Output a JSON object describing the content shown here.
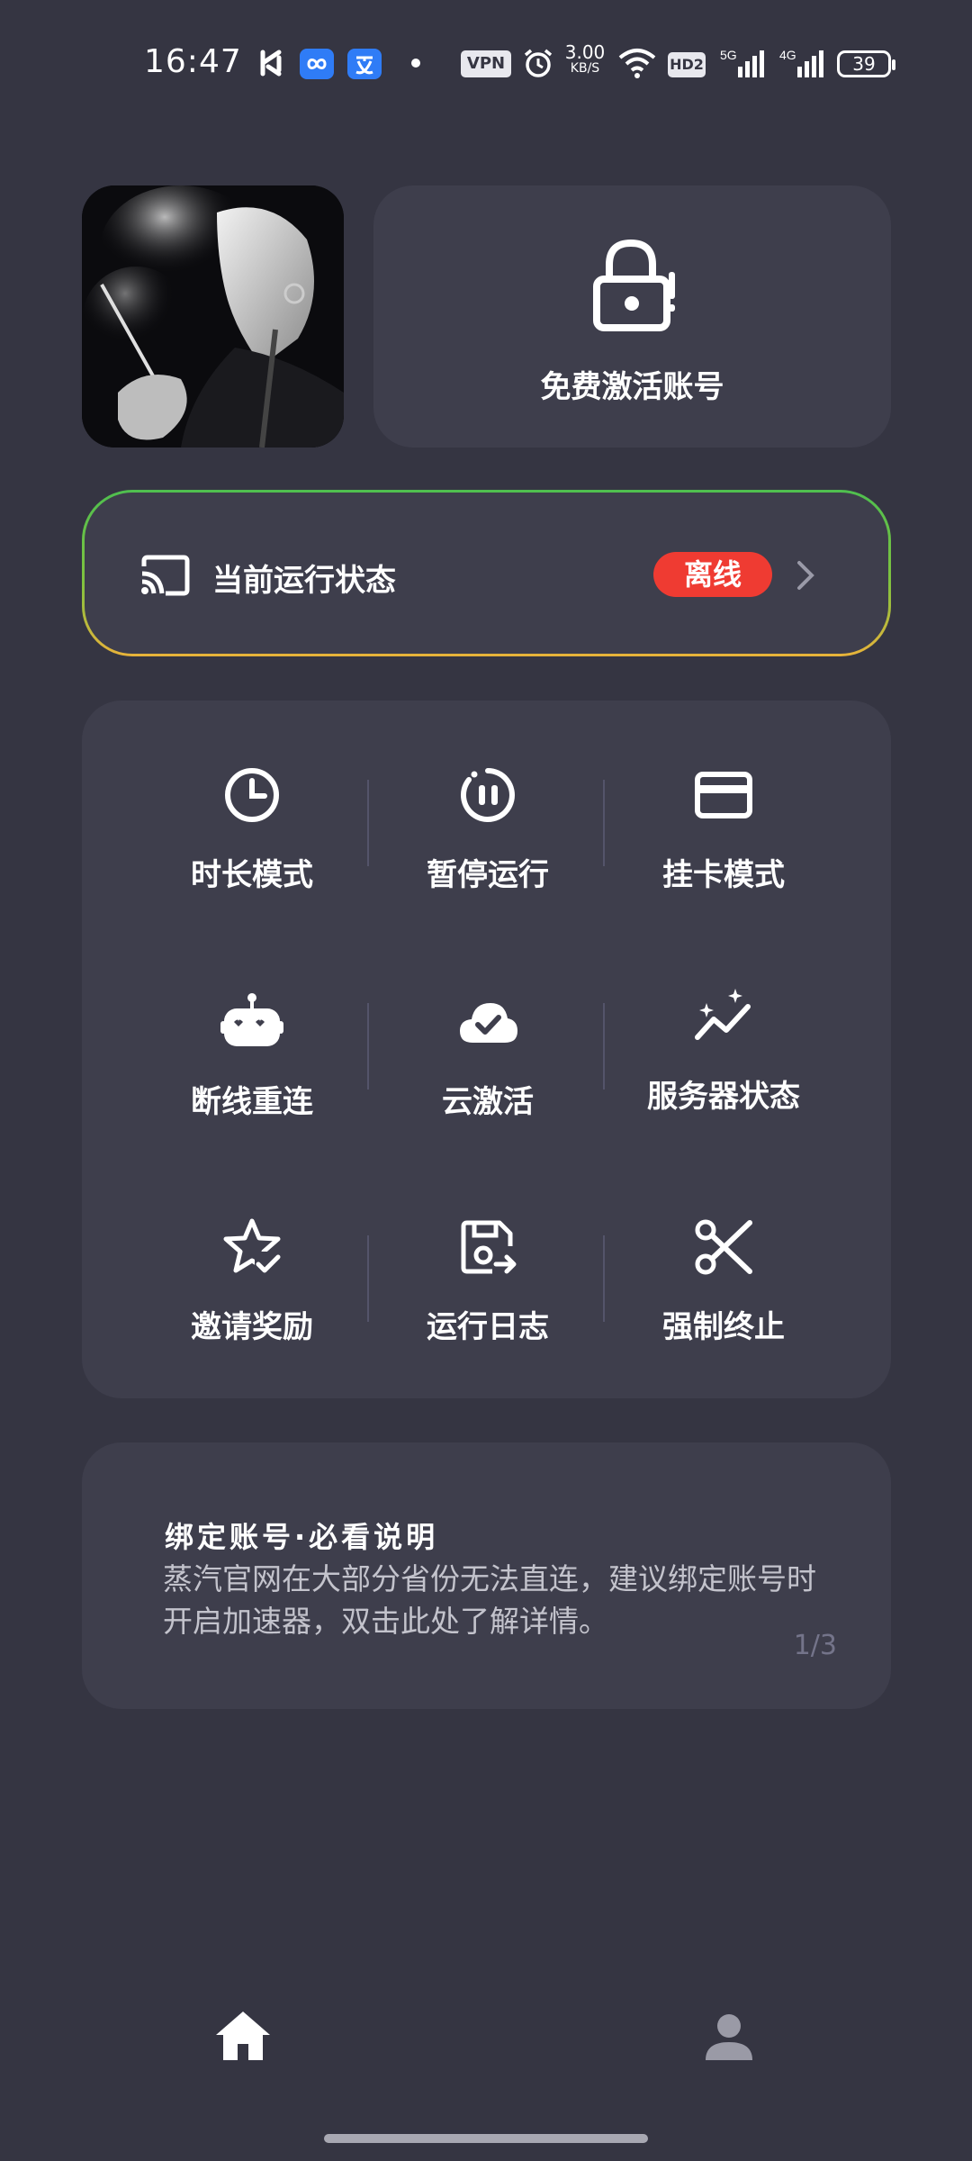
{
  "status_bar": {
    "time": "16:47",
    "vpn": "VPN",
    "speed_value": "3.00",
    "speed_unit": "KB/S",
    "hd": "HD2",
    "network_5g": "5G",
    "network_4g": "4G",
    "battery": "39"
  },
  "account": {
    "activate_label": "免费激活账号"
  },
  "run_status": {
    "label": "当前运行状态",
    "badge": "离线",
    "badge_color": "#ef3b32"
  },
  "grid": [
    {
      "label": "时长模式",
      "icon": "clock-icon"
    },
    {
      "label": "暂停运行",
      "icon": "pause-icon"
    },
    {
      "label": "挂卡模式",
      "icon": "card-icon"
    },
    {
      "label": "断线重连",
      "icon": "robot-icon"
    },
    {
      "label": "云激活",
      "icon": "cloud-check-icon"
    },
    {
      "label": "服务器状态",
      "icon": "trend-sparkle-icon"
    },
    {
      "label": "邀请奖励",
      "icon": "star-check-icon"
    },
    {
      "label": "运行日志",
      "icon": "save-log-icon"
    },
    {
      "label": "强制终止",
      "icon": "scissors-icon"
    }
  ],
  "notice": {
    "title": "绑定账号·必看说明",
    "body": "蒸汽官网在大部分省份无法直连，建议绑定账号时开启加速器，双击此处了解详情。",
    "page": "1/3"
  },
  "bottom_nav": {
    "items": [
      {
        "icon": "home-icon",
        "active": true
      },
      {
        "icon": "profile-icon",
        "active": false
      }
    ]
  }
}
